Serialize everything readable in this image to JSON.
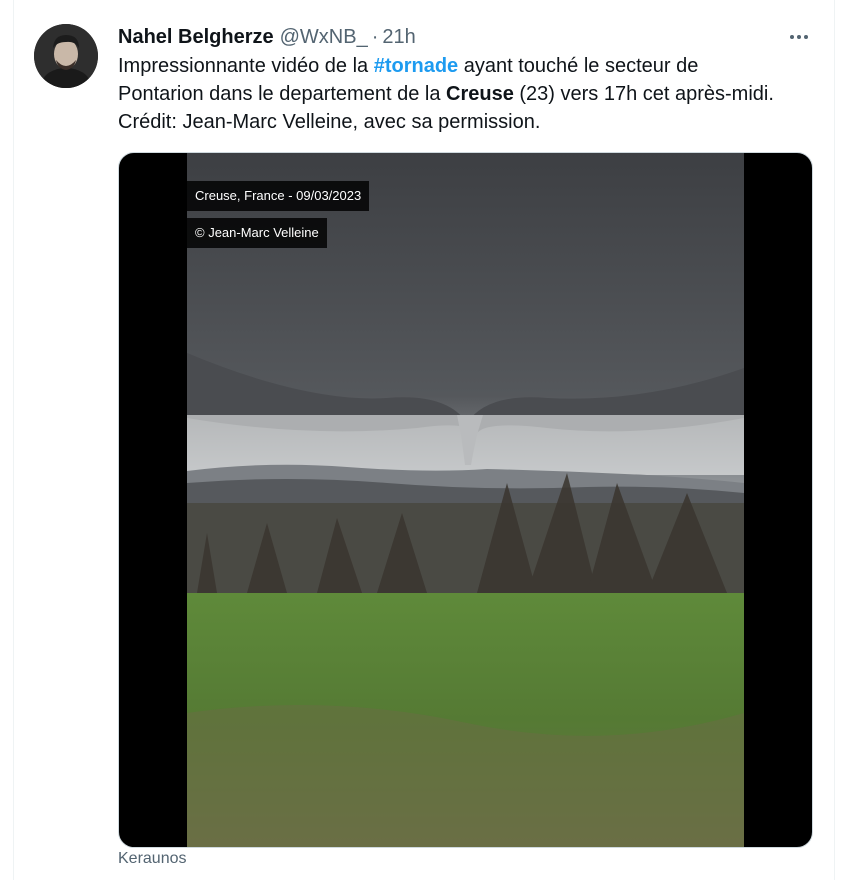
{
  "tweet": {
    "author_name": "Nahel Belgherze",
    "handle": "@WxNB_",
    "separator": "·",
    "time": "21h",
    "more_label": "···",
    "text": {
      "line1_a": "Impressionnante vidéo de la ",
      "hashtag": "#tornade",
      "line1_b": " ayant touché le secteur de",
      "line2_a": "Pontarion dans le departement de la ",
      "bold_word": "Creuse",
      "line2_b": " (23) vers 17h cet après-midi.",
      "line3": "Crédit: Jean-Marc Velleine, avec sa permission."
    }
  },
  "media": {
    "overlay_location_date": "Creuse, France - 09/03/2023",
    "overlay_credit": "© Jean-Marc Velleine",
    "source_label": "Keraunos"
  },
  "colors": {
    "link": "#1d9bf0",
    "secondary_text": "#536471",
    "primary_text": "#0f1419"
  }
}
